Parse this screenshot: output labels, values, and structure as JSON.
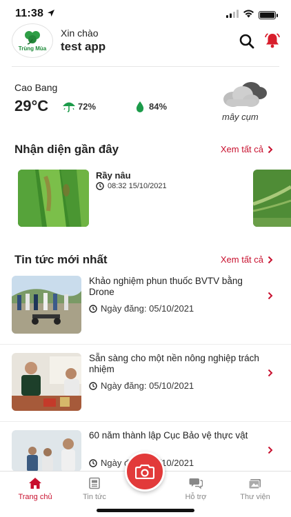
{
  "status_bar": {
    "time": "11:38"
  },
  "header": {
    "logo_text": "Trùng Mùa",
    "greeting": "Xin chào",
    "username": "test app"
  },
  "weather": {
    "city": "Cao Bang",
    "temperature": "29°C",
    "rain_chance": "72%",
    "humidity": "84%",
    "description": "mây cụm"
  },
  "recent_recognition": {
    "title": "Nhận diện gần đây",
    "see_all": "Xem tất cả",
    "items": [
      {
        "name": "Rầy nâu",
        "time": "08:32 15/10/2021"
      }
    ]
  },
  "latest_news": {
    "title": "Tin tức mới nhất",
    "see_all": "Xem tất cả",
    "items": [
      {
        "title": "Khảo nghiệm phun thuốc BVTV bằng Drone",
        "date": "Ngày đăng: 05/10/2021"
      },
      {
        "title": "Sẵn sàng cho một nền nông nghiệp trách nhiệm",
        "date": "Ngày đăng: 05/10/2021"
      },
      {
        "title": "60 năm thành lập Cục Bảo vệ thực vật",
        "date": "Ngày đăng: 05/10/2021"
      }
    ]
  },
  "tab_bar": {
    "tabs": [
      {
        "label": "Trang chủ",
        "icon": "home-icon",
        "active": true
      },
      {
        "label": "Tin tức",
        "icon": "newspaper-icon",
        "active": false
      },
      {
        "label": "Hỗ trợ",
        "icon": "chat-icon",
        "active": false
      },
      {
        "label": "Thư viện",
        "icon": "library-icon",
        "active": false
      }
    ]
  },
  "colors": {
    "accent": "#c8102e",
    "fab": "#e23a3a",
    "brand_green": "#1c8a38"
  }
}
